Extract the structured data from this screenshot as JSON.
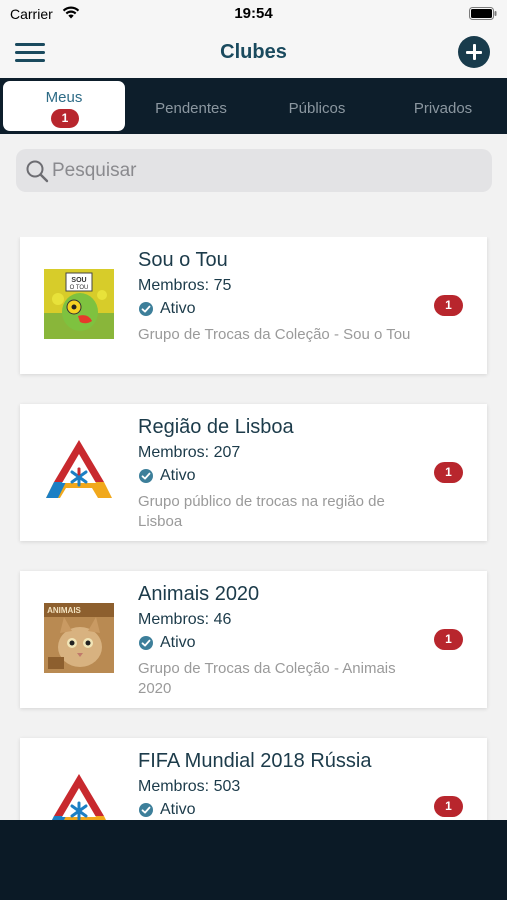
{
  "status_bar": {
    "carrier": "Carrier",
    "time": "19:54"
  },
  "nav": {
    "title": "Clubes"
  },
  "tabs": [
    {
      "label": "Meus",
      "badge": "1",
      "active": true
    },
    {
      "label": "Pendentes"
    },
    {
      "label": "Públicos"
    },
    {
      "label": "Privados"
    }
  ],
  "search": {
    "placeholder": "Pesquisar",
    "value": ""
  },
  "clubs": [
    {
      "name": "Sou o Tou",
      "members": "Membros: 75",
      "status": "Ativo",
      "description": "Grupo de Trocas da Coleção - Sou o Tou",
      "badge": "1",
      "logo": "sou-o-tou-cover"
    },
    {
      "name": "Região de Lisboa",
      "members": "Membros: 207",
      "status": "Ativo",
      "description": "Grupo público de trocas na região de Lisboa",
      "badge": "1",
      "logo": "triangle-logo"
    },
    {
      "name": "Animais 2020",
      "members": "Membros: 46",
      "status": "Ativo",
      "description": "Grupo de Trocas da Coleção - Animais 2020",
      "badge": "1",
      "logo": "animais-cover"
    },
    {
      "name": "FIFA Mundial 2018 Rússia",
      "members": "Membros: 503",
      "status": "Ativo",
      "description": "",
      "badge": "1",
      "logo": "triangle-logo"
    }
  ],
  "colors": {
    "accent": "#1a4a5e",
    "badge": "#b8262d",
    "tab_bar": "#0d1e2b",
    "check": "#3d7f9a"
  }
}
